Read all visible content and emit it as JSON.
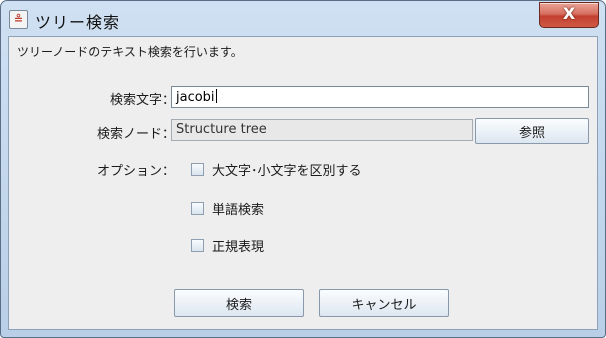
{
  "window": {
    "title": "ツリー検索",
    "close_label": "X",
    "app_icon_glyph": "≗"
  },
  "description": "ツリーノードのテキスト検索を行います。",
  "search_text": {
    "label": "検索文字：",
    "value": "jacobi"
  },
  "search_node": {
    "label": "検索ノード：",
    "value": "Structure tree",
    "browse_label": "参照"
  },
  "options": {
    "label": "オプション：",
    "items": [
      {
        "label": "大文字･小文字を区別する",
        "checked": false
      },
      {
        "label": "単語検索",
        "checked": false
      },
      {
        "label": "正規表現",
        "checked": false
      }
    ]
  },
  "buttons": {
    "search": "検索",
    "cancel": "キャンセル"
  }
}
